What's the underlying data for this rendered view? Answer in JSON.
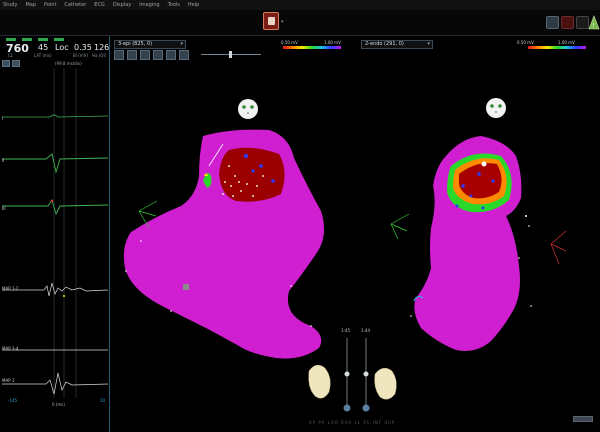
{
  "menu": [
    "Study",
    "Map",
    "Point",
    "Catheter",
    "ECG",
    "Display",
    "Imaging",
    "Tools",
    "Help"
  ],
  "stats": {
    "cl": {
      "value": "760",
      "label": "CL"
    },
    "lat": {
      "value": "45",
      "label": "LAT (ms)"
    },
    "loc": {
      "value": "Loc",
      "label": ""
    },
    "bi": {
      "value": "0.35",
      "label": "Bi (mV)"
    },
    "uni": {
      "value": "126",
      "label": "Ha (Ol)"
    }
  },
  "ecg": {
    "scale_text": "(99.8 ms/div)",
    "channels": [
      "I",
      "II",
      "III",
      "MAP 1-2",
      "MAP 3-4",
      "MAP 1"
    ],
    "footer_left": "-145",
    "footer_mid": "0 (ms)",
    "footer_right": "10"
  },
  "maps": {
    "left_select": "3-epi (825, 0)",
    "right_select": "2-endo (291, 0)",
    "left_legend": {
      "min": "0.50 mV",
      "max": "1.00 mV"
    },
    "right_legend": {
      "min": "0.50 mV",
      "max": "1.00 mV"
    },
    "dual_left": "1:45",
    "dual_right": "1:44",
    "view_buttons": "AP PA LAO RAO LL RL INF SUP"
  },
  "colors": {
    "shell": "#d61fd6",
    "scar_red": "#b30000",
    "accent_blue": "#1e82b4",
    "orientation_green": "#33cc33",
    "orientation_red": "#d23030"
  },
  "icons": [
    "status-leds",
    "map-tool-icons",
    "face-orientation-icon",
    "heart-orientation-icon",
    "axis-orientation-icon"
  ]
}
